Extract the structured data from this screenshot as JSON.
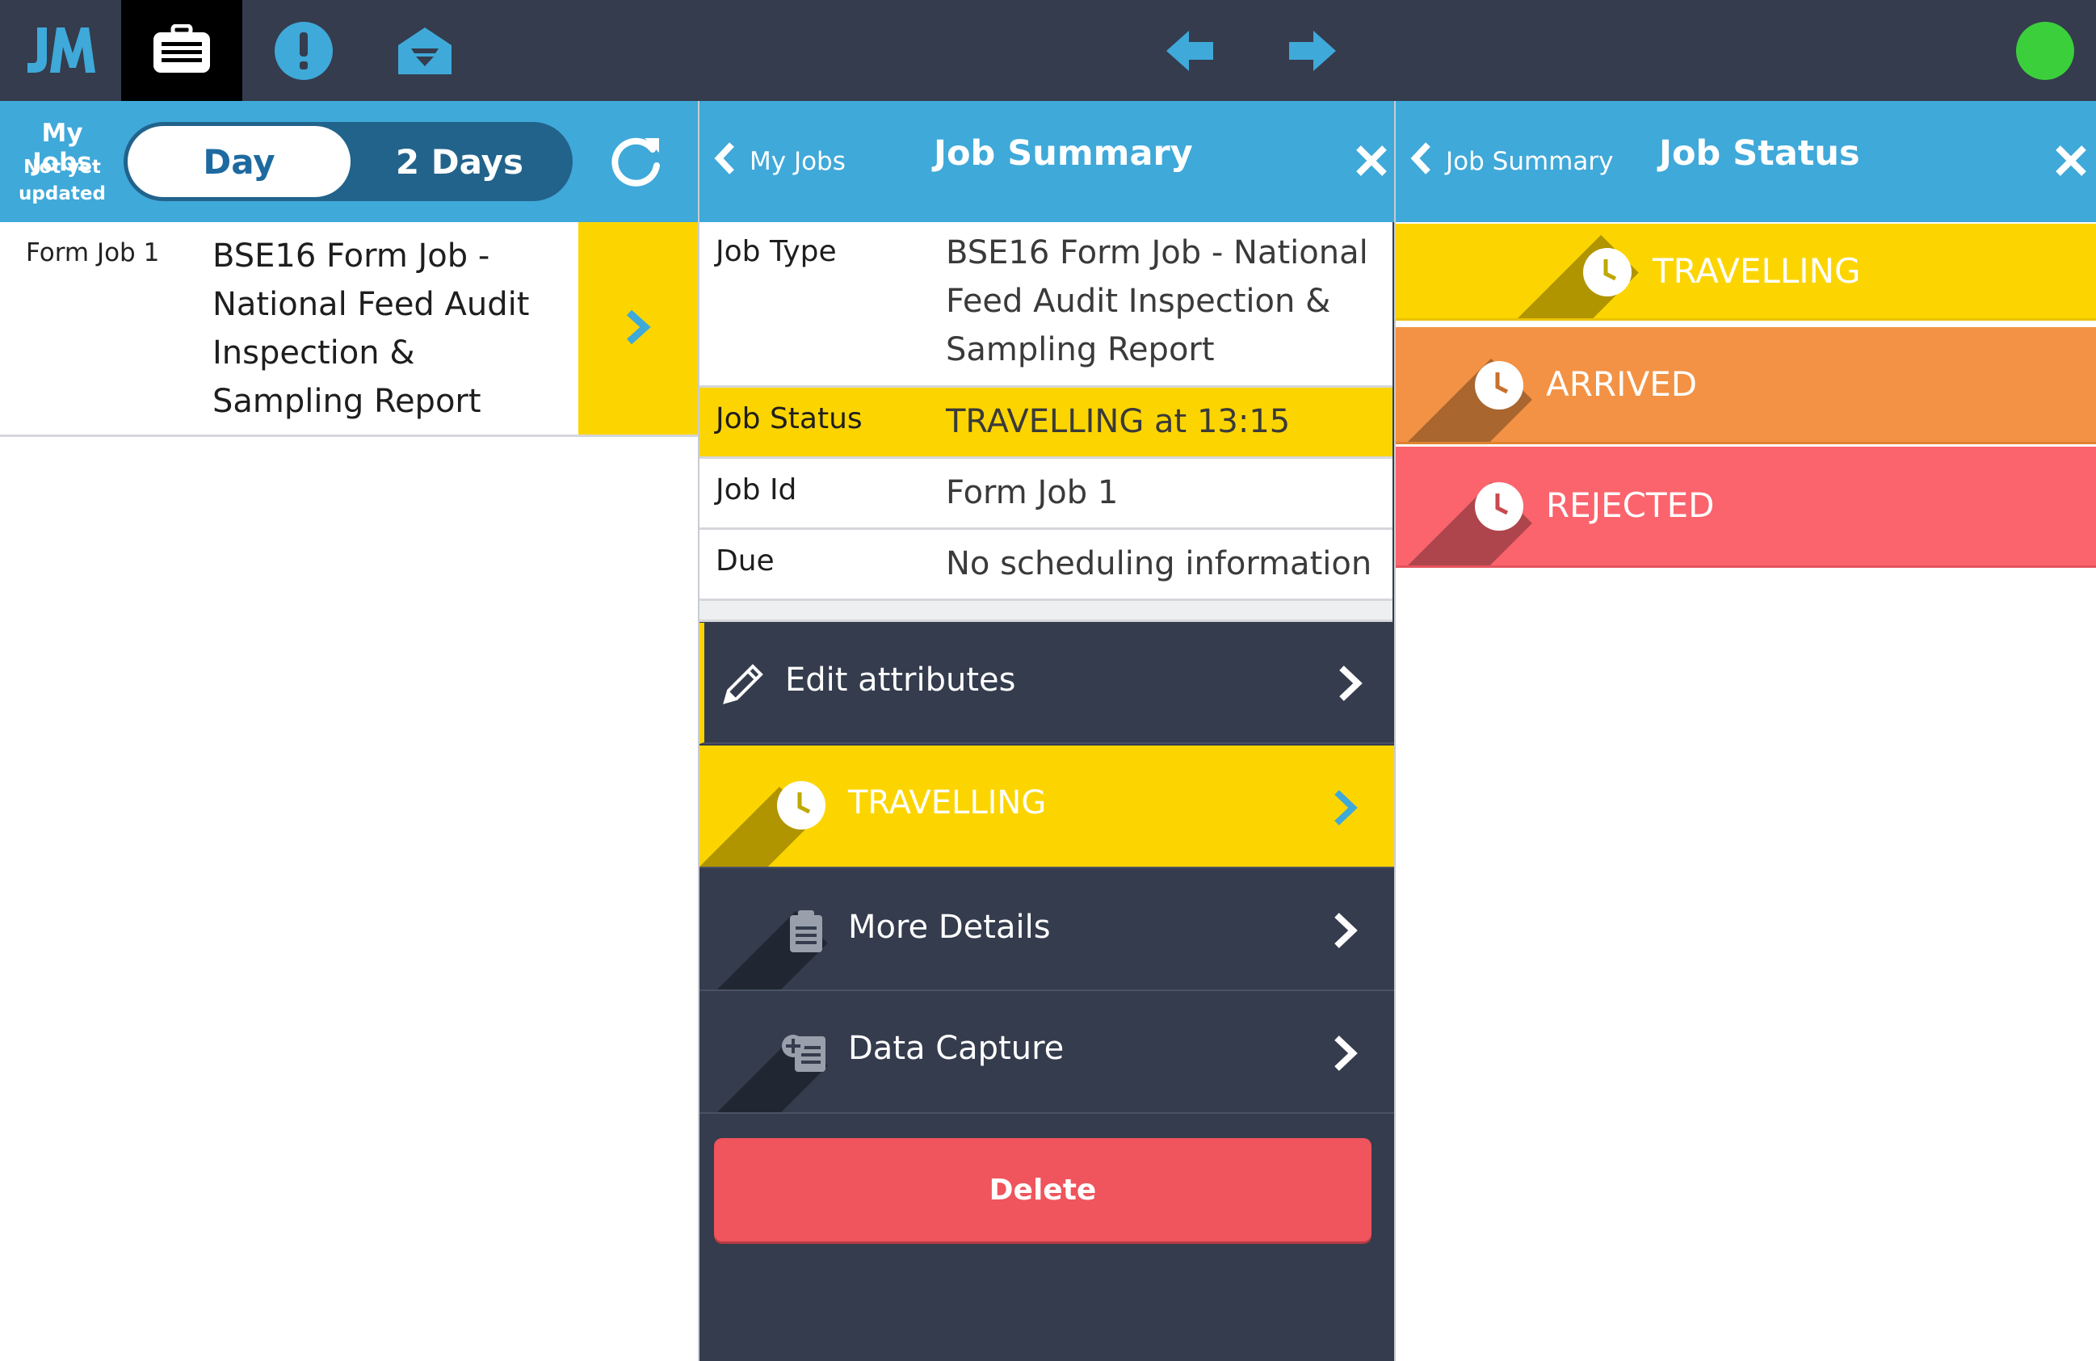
{
  "topbar": {
    "logo_text": "JM",
    "icons": [
      "jobs-briefcase-icon",
      "alert-icon",
      "messages-icon",
      "arrow-left-icon",
      "arrow-right-icon"
    ],
    "status_color": "#3ccf3c"
  },
  "my_jobs": {
    "title": "My Jobs",
    "subtitle_line1": "Not yet",
    "subtitle_line2": "updated",
    "toggle": {
      "day": "Day",
      "two_days": "2 Days",
      "selected": "Day"
    },
    "jobs": [
      {
        "id": "Form Job 1",
        "title": "BSE16 Form Job - National Feed Audit Inspection & Sampling Report",
        "status_color": "#fcd500"
      }
    ]
  },
  "job_summary": {
    "back_label": "My Jobs",
    "title": "Job Summary",
    "rows": {
      "job_type": {
        "label": "Job Type",
        "value": "BSE16 Form Job - National Feed Audit Inspection & Sampling Report"
      },
      "job_status": {
        "label": "Job Status",
        "value": "TRAVELLING at 13:15"
      },
      "job_id": {
        "label": "Job Id",
        "value": "Form Job 1"
      },
      "due": {
        "label": "Due",
        "value": "No scheduling information"
      }
    },
    "actions": {
      "edit": "Edit attributes",
      "travelling": "TRAVELLING",
      "more_details": "More Details",
      "data_capture": "Data Capture"
    },
    "delete_label": "Delete"
  },
  "job_status": {
    "back_label": "Job Summary",
    "title": "Job Status",
    "statuses": [
      {
        "label": "TRAVELLING",
        "color": "#fcd500"
      },
      {
        "label": "ARRIVED",
        "color": "#f39244"
      },
      {
        "label": "REJECTED",
        "color": "#fb646d"
      }
    ]
  },
  "colors": {
    "topbar": "#343c4d",
    "header_blue": "#3fa9d9",
    "dark_panel": "#343c4d",
    "travelling_yellow": "#fcd500",
    "arrived_orange": "#f39244",
    "rejected_red": "#fb646d",
    "delete_red": "#f0545c"
  }
}
